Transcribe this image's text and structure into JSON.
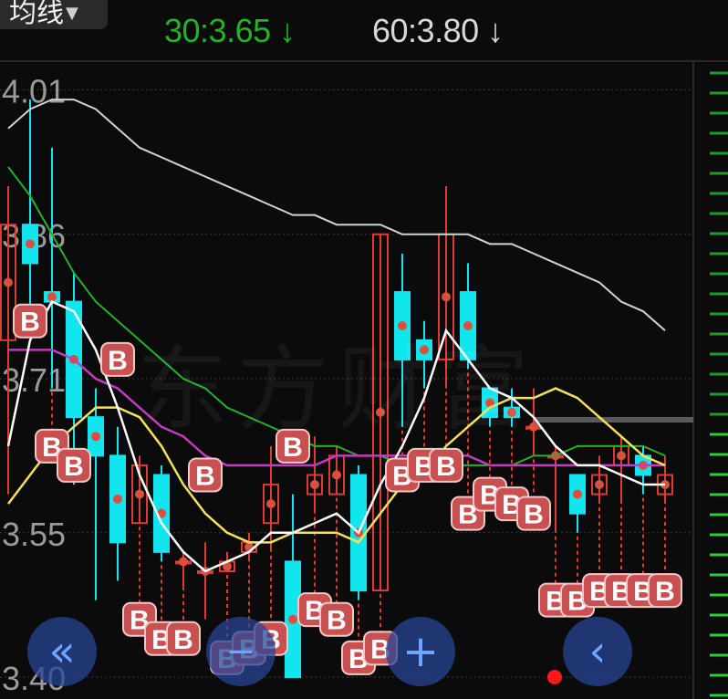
{
  "toolbar": {
    "ma_select_label": "均线",
    "ma30_text": "30:3.65 ↓",
    "ma60_text": "60:3.80 ↓"
  },
  "watermark": "东方财富",
  "nav": {
    "rewind_icon": "«",
    "zoom_in_icon": "+",
    "back_icon": "‹"
  },
  "colors": {
    "up": "#e0383c",
    "down": "#11e6ef",
    "ma5": "#ffffff",
    "ma10": "#f3e15a",
    "ma20": "#c23bc0",
    "ma30": "#22b32a",
    "ma60": "#d2d2d2",
    "grid": "#3a3a3a",
    "b_marker": "#c85050"
  },
  "chart_data": {
    "type": "candlestick",
    "y_range": [
      3.4,
      4.02
    ],
    "y_ticks": [
      "4.01",
      "3.86",
      "3.71",
      "3.55",
      "3.40"
    ],
    "candles": [
      {
        "o": 3.75,
        "c": 3.87,
        "h": 3.91,
        "l": 3.59
      },
      {
        "o": 3.87,
        "c": 3.83,
        "h": 4.0,
        "l": 3.78
      },
      {
        "o": 3.8,
        "c": 3.79,
        "h": 3.95,
        "l": 3.7
      },
      {
        "o": 3.79,
        "c": 3.67,
        "h": 3.82,
        "l": 3.6
      },
      {
        "o": 3.67,
        "c": 3.63,
        "h": 3.7,
        "l": 3.48
      },
      {
        "o": 3.63,
        "c": 3.54,
        "h": 3.66,
        "l": 3.5
      },
      {
        "o": 3.56,
        "c": 3.62,
        "h": 3.63,
        "l": 3.56
      },
      {
        "o": 3.61,
        "c": 3.53,
        "h": 3.62,
        "l": 3.52
      },
      {
        "o": 3.52,
        "c": 3.52,
        "h": 3.53,
        "l": 3.49
      },
      {
        "o": 3.51,
        "c": 3.51,
        "h": 3.54,
        "l": 3.46
      },
      {
        "o": 3.51,
        "c": 3.52,
        "h": 3.53,
        "l": 3.51
      },
      {
        "o": 3.53,
        "c": 3.54,
        "h": 3.55,
        "l": 3.52
      },
      {
        "o": 3.56,
        "c": 3.6,
        "h": 3.64,
        "l": 3.53
      },
      {
        "o": 3.52,
        "c": 3.4,
        "h": 3.59,
        "l": 3.4
      },
      {
        "o": 3.59,
        "c": 3.61,
        "h": 3.65,
        "l": 3.57
      },
      {
        "o": 3.59,
        "c": 3.63,
        "h": 3.64,
        "l": 3.59
      },
      {
        "o": 3.61,
        "c": 3.49,
        "h": 3.62,
        "l": 3.48
      },
      {
        "o": 3.49,
        "c": 3.86,
        "h": 3.86,
        "l": 3.49
      },
      {
        "o": 3.8,
        "c": 3.73,
        "h": 3.84,
        "l": 3.66
      },
      {
        "o": 3.75,
        "c": 3.73,
        "h": 3.77,
        "l": 3.7
      },
      {
        "o": 3.73,
        "c": 3.86,
        "h": 3.91,
        "l": 3.7
      },
      {
        "o": 3.8,
        "c": 3.73,
        "h": 3.83,
        "l": 3.72
      },
      {
        "o": 3.7,
        "c": 3.67,
        "h": 3.7,
        "l": 3.66
      },
      {
        "o": 3.68,
        "c": 3.67,
        "h": 3.7,
        "l": 3.66
      },
      {
        "o": 3.66,
        "c": 3.66,
        "h": 3.7,
        "l": 3.63
      },
      {
        "o": 3.63,
        "c": 3.63,
        "h": 3.64,
        "l": 3.55
      },
      {
        "o": 3.61,
        "c": 3.57,
        "h": 3.61,
        "l": 3.55
      },
      {
        "o": 3.59,
        "c": 3.61,
        "h": 3.63,
        "l": 3.58
      },
      {
        "o": 3.62,
        "c": 3.64,
        "h": 3.65,
        "l": 3.58
      },
      {
        "o": 3.63,
        "c": 3.61,
        "h": 3.64,
        "l": 3.59
      },
      {
        "o": 3.59,
        "c": 3.61,
        "h": 3.63,
        "l": 3.58
      }
    ],
    "ma5": [
      3.64,
      3.75,
      3.79,
      3.78,
      3.74,
      3.68,
      3.61,
      3.56,
      3.53,
      3.51,
      3.52,
      3.53,
      3.55,
      3.55,
      3.56,
      3.57,
      3.55,
      3.6,
      3.64,
      3.69,
      3.76,
      3.73,
      3.7,
      3.69,
      3.67,
      3.64,
      3.62,
      3.62,
      3.61,
      3.6,
      3.6
    ],
    "ma10": [
      3.58,
      3.61,
      3.64,
      3.66,
      3.68,
      3.68,
      3.67,
      3.64,
      3.6,
      3.57,
      3.55,
      3.54,
      3.54,
      3.55,
      3.55,
      3.55,
      3.54,
      3.57,
      3.6,
      3.61,
      3.64,
      3.66,
      3.68,
      3.69,
      3.69,
      3.7,
      3.69,
      3.67,
      3.65,
      3.63,
      3.62
    ],
    "ma20": [
      3.74,
      3.74,
      3.74,
      3.73,
      3.71,
      3.7,
      3.68,
      3.66,
      3.65,
      3.63,
      3.62,
      3.62,
      3.62,
      3.62,
      3.62,
      3.63,
      3.63,
      3.63,
      3.63,
      3.63,
      3.63,
      3.63,
      3.62,
      3.62,
      3.62,
      3.62,
      3.62,
      3.62,
      3.62,
      3.62,
      3.62
    ],
    "ma30": [
      3.93,
      3.9,
      3.86,
      3.82,
      3.79,
      3.77,
      3.75,
      3.73,
      3.71,
      3.7,
      3.68,
      3.67,
      3.66,
      3.65,
      3.64,
      3.64,
      3.63,
      3.63,
      3.62,
      3.62,
      3.62,
      3.62,
      3.62,
      3.62,
      3.63,
      3.63,
      3.64,
      3.64,
      3.64,
      3.64,
      3.63
    ],
    "ma60": [
      3.97,
      3.99,
      4.0,
      4.0,
      3.99,
      3.97,
      3.95,
      3.94,
      3.93,
      3.92,
      3.91,
      3.9,
      3.89,
      3.88,
      3.88,
      3.87,
      3.87,
      3.87,
      3.86,
      3.86,
      3.86,
      3.86,
      3.85,
      3.85,
      3.84,
      3.83,
      3.82,
      3.81,
      3.79,
      3.78,
      3.76
    ],
    "b_markers": [
      {
        "i": 1,
        "level": 3.77
      },
      {
        "i": 2,
        "level": 3.64
      },
      {
        "i": 3,
        "level": 3.62
      },
      {
        "i": 5,
        "level": 3.73
      },
      {
        "i": 6,
        "level": 3.46
      },
      {
        "i": 7,
        "level": 3.44
      },
      {
        "i": 8,
        "level": 3.44
      },
      {
        "i": 9,
        "level": 3.61
      },
      {
        "i": 10,
        "level": 3.42
      },
      {
        "i": 11,
        "level": 3.43
      },
      {
        "i": 12,
        "level": 3.44
      },
      {
        "i": 13,
        "level": 3.64
      },
      {
        "i": 14,
        "level": 3.47
      },
      {
        "i": 15,
        "level": 3.46
      },
      {
        "i": 16,
        "level": 3.42
      },
      {
        "i": 17,
        "level": 3.43
      },
      {
        "i": 18,
        "level": 3.61
      },
      {
        "i": 19,
        "level": 3.62
      },
      {
        "i": 20,
        "level": 3.62
      },
      {
        "i": 21,
        "level": 3.57
      },
      {
        "i": 22,
        "level": 3.59
      },
      {
        "i": 23,
        "level": 3.58
      },
      {
        "i": 24,
        "level": 3.57
      },
      {
        "i": 25,
        "level": 3.48
      },
      {
        "i": 26,
        "level": 3.48
      },
      {
        "i": 27,
        "level": 3.49
      },
      {
        "i": 28,
        "level": 3.49
      },
      {
        "i": 29,
        "level": 3.49
      },
      {
        "i": 30,
        "level": 3.49
      }
    ]
  }
}
